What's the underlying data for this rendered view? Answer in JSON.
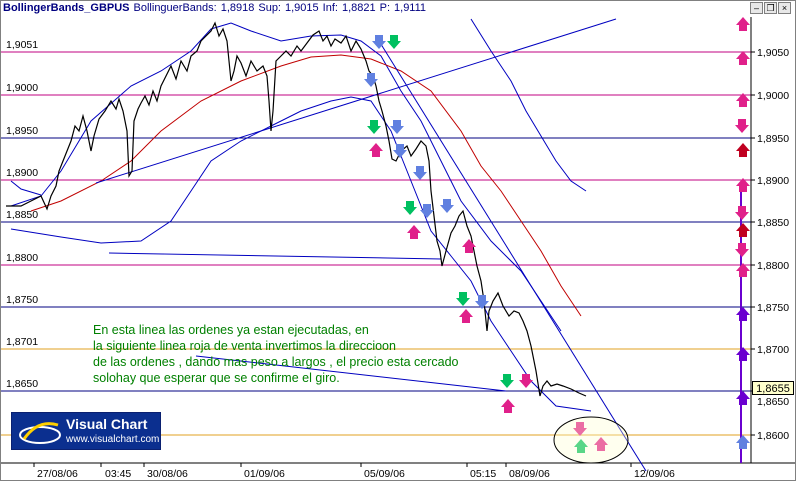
{
  "window": {
    "indicator_name": "BollingerBands_GBPUS",
    "indicator_label": "BollinguerBands:",
    "indicator_value": "1,8918",
    "sup_label": "Sup:",
    "sup_value": "1,9015",
    "inf_label": "Inf:",
    "inf_value": "1,8821",
    "p_label": "P:",
    "p_value": "1,9111",
    "minimize_icon": "minimize-icon",
    "restore_icon": "restore-icon",
    "close_icon": "close-icon"
  },
  "price_axis": {
    "left_labels": [
      "1,9051",
      "1,9000",
      "1,8950",
      "1,8900",
      "1,8850",
      "1,8800",
      "1,8750",
      "1,8701",
      "1,8650"
    ],
    "right_labels": [
      "1,9050",
      "1,9000",
      "1,8950",
      "1,8900",
      "1,8850",
      "1,8800",
      "1,8750",
      "1,8700",
      "1,8650",
      "1,8600"
    ],
    "last_price": "1,8655"
  },
  "time_axis": {
    "labels": [
      "27/08/06",
      "03:45",
      "30/08/06",
      "01/09/06",
      "05/09/06",
      "05:15",
      "08/09/06",
      "12/09/06"
    ]
  },
  "annotation": {
    "lines": [
      "En esta linea las ordenes ya estan ejecutadas, en",
      "la siguiente linea roja de venta invertimos la direccioon",
      "de las ordenes , dando mas peso a largos , el precio esta cercado",
      "solohay que esperar que se confirme el giro."
    ]
  },
  "logo": {
    "title": "Visual Chart",
    "url": "www.visualchart.com"
  },
  "colors": {
    "price_line": "#000000",
    "bollinger_bands": "#0000c0",
    "moving_average": "#c00000",
    "level_magenta": "#c00080",
    "level_navy": "#000080",
    "level_orange": "#e0a020",
    "arrow_buy": "#00c060",
    "arrow_sell": "#e0208a",
    "arrow_blue": "#6080e0",
    "arrow_purple": "#6a00d0"
  }
}
